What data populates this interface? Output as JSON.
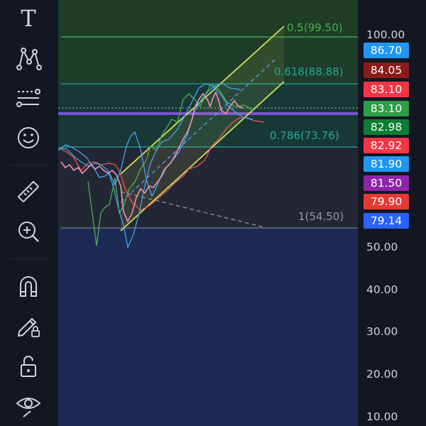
{
  "toolbar": {
    "tools": [
      {
        "name": "text-tool-icon",
        "glyph": "T"
      },
      {
        "name": "pattern-tool-icon"
      },
      {
        "name": "fib-retracement-tool-icon"
      },
      {
        "name": "emoji-tool-icon"
      },
      {
        "name": "ruler-tool-icon"
      },
      {
        "name": "zoom-in-icon"
      },
      {
        "name": "magnet-icon"
      },
      {
        "name": "lock-drawing-icon"
      },
      {
        "name": "unlock-icon"
      },
      {
        "name": "eye-icon"
      }
    ]
  },
  "fib_labels": {
    "l0_5": "0.5(99.50)",
    "l0_618": "0.618(88.88)",
    "l0_786": "0.786(73.76)",
    "l1": "1(54.50)"
  },
  "price_axis": {
    "ticks": [
      "100.00",
      "50.00",
      "40.00",
      "30.00",
      "20.00",
      "10.00"
    ]
  },
  "price_tags": [
    {
      "value": "86.70",
      "color": "#2196f3"
    },
    {
      "value": "84.05",
      "color": "#8b1a1a"
    },
    {
      "value": "83.10",
      "color": "#f23645"
    },
    {
      "value": "83.10",
      "color": "#2e9e47"
    },
    {
      "value": "82.98",
      "color": "#0a7d34"
    },
    {
      "value": "82.92",
      "color": "#f23645"
    },
    {
      "value": "81.90",
      "color": "#2196f3"
    },
    {
      "value": "81.50",
      "color": "#8e24aa"
    },
    {
      "value": "79.90",
      "color": "#e53935"
    },
    {
      "value": "79.14",
      "color": "#2962ff"
    }
  ],
  "colors": {
    "background": "#131722",
    "lower_zone": "#1c2a55",
    "fib_green": "#4caf50",
    "fib_teal": "#26a69a",
    "channel": "#d4e157",
    "purple_line": "#7b4fd8"
  }
}
